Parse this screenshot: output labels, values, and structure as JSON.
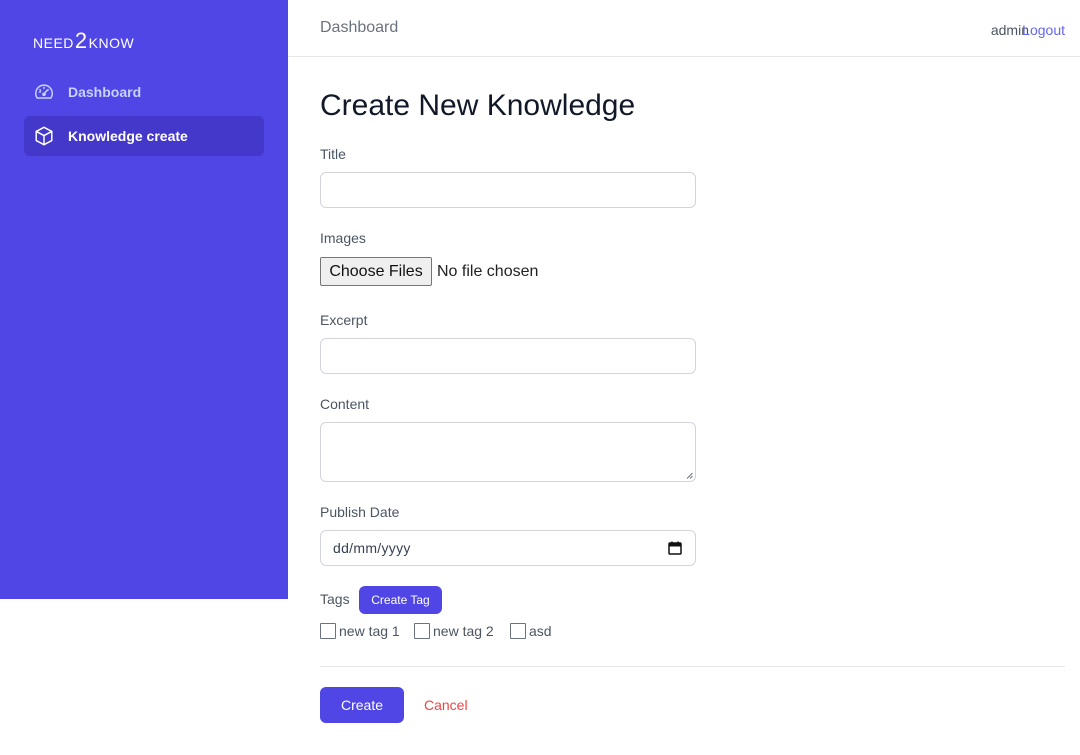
{
  "brand": {
    "prefix": "NEED",
    "number": "2",
    "suffix": "KNOW"
  },
  "sidebar": {
    "items": [
      {
        "label": "Dashboard",
        "icon": "gauge-icon",
        "active": false
      },
      {
        "label": "Knowledge create",
        "icon": "cube-icon",
        "active": true
      }
    ]
  },
  "header": {
    "breadcrumb": "Dashboard",
    "user": "admin",
    "logout": "Logout"
  },
  "form": {
    "heading": "Create New Knowledge",
    "title_label": "Title",
    "title_value": "",
    "images_label": "Images",
    "file_button": "Choose Files",
    "file_status": "No file chosen",
    "excerpt_label": "Excerpt",
    "excerpt_value": "",
    "content_label": "Content",
    "content_value": "",
    "publish_label": "Publish Date",
    "publish_placeholder": "dd/mm/yyyy",
    "tags_label": "Tags",
    "create_tag_button": "Create Tag",
    "tags": [
      {
        "label": "new tag 1",
        "checked": false
      },
      {
        "label": "new tag 2",
        "checked": false
      },
      {
        "label": "asd",
        "checked": false
      }
    ],
    "submit_button": "Create",
    "cancel_button": "Cancel"
  },
  "colors": {
    "primary": "#4f46e5",
    "sidebar_active": "#4338ca",
    "cancel": "#ef4444",
    "link": "#6366f1"
  }
}
